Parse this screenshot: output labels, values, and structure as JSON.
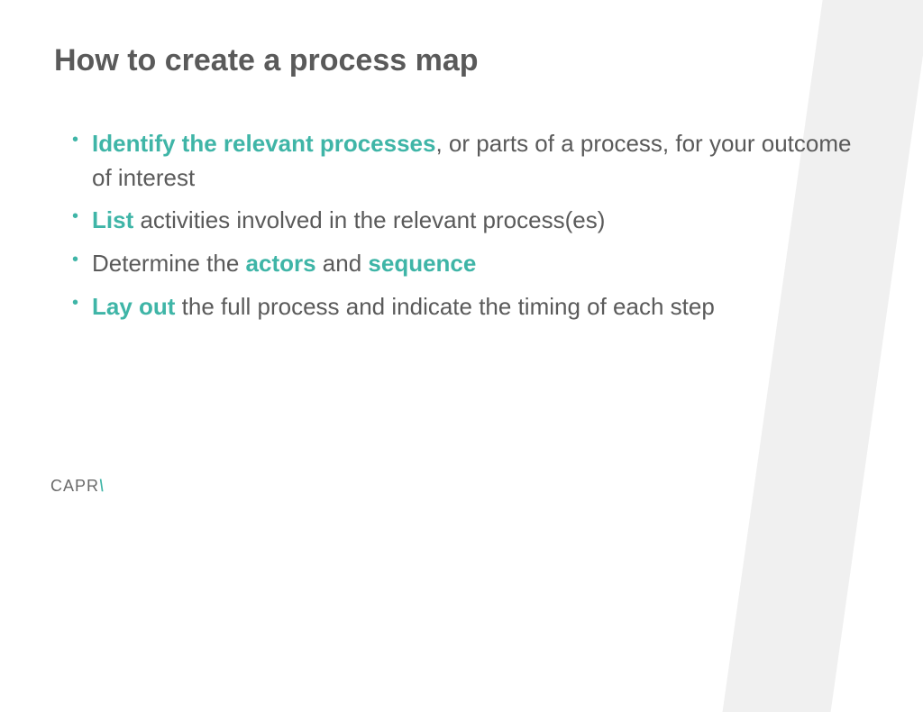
{
  "title": "How to create a process map",
  "bullets": [
    {
      "segments": [
        {
          "text": "Identify the relevant processes",
          "highlight": true
        },
        {
          "text": ", or parts of a process, for your outcome of interest",
          "highlight": false
        }
      ]
    },
    {
      "segments": [
        {
          "text": "List",
          "highlight": true
        },
        {
          "text": " activities involved in the relevant process(es)",
          "highlight": false
        }
      ]
    },
    {
      "segments": [
        {
          "text": "Determine the ",
          "highlight": false
        },
        {
          "text": "actors",
          "highlight": true
        },
        {
          "text": " and ",
          "highlight": false
        },
        {
          "text": "sequence",
          "highlight": true
        }
      ]
    },
    {
      "segments": [
        {
          "text": "Lay out",
          "highlight": true
        },
        {
          "text": " the full process and indicate the timing of each step",
          "highlight": false
        }
      ]
    }
  ],
  "logo": {
    "text": "CAPR",
    "slash": "\\"
  }
}
